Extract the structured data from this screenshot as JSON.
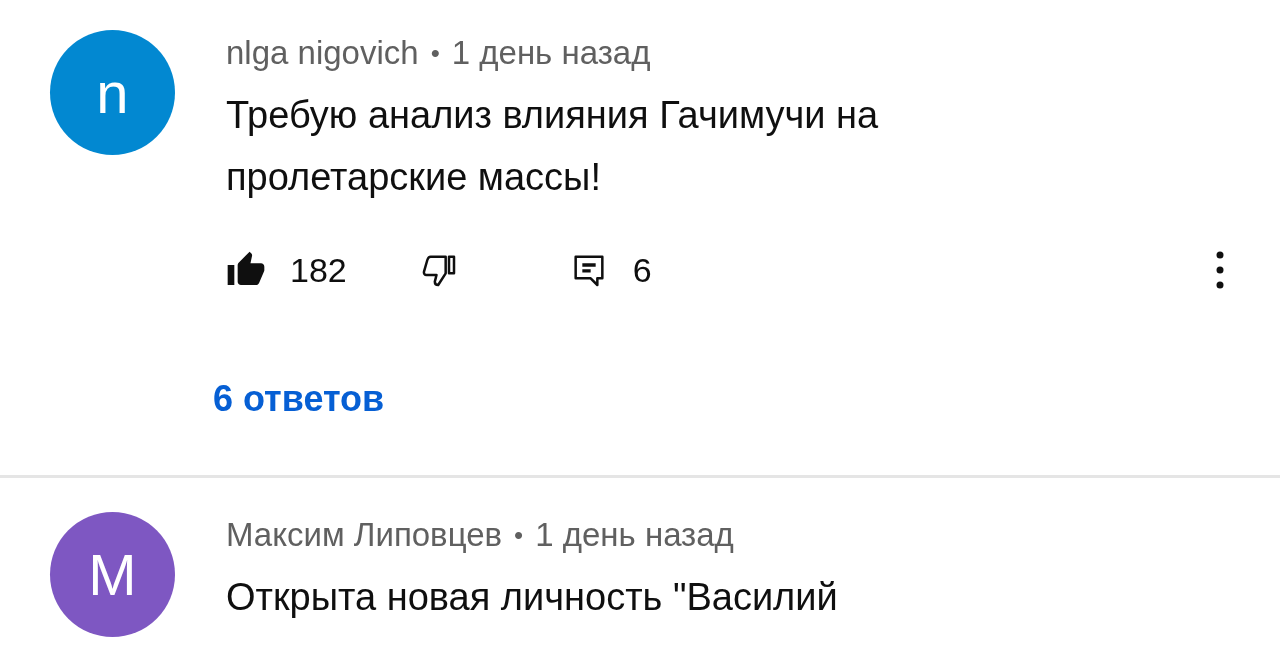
{
  "comments": [
    {
      "avatar_letter": "n",
      "color": "#0288d1",
      "author": "nlga nigovich",
      "separator": "•",
      "time": "1 день назад",
      "text": "Требую анализ влияния Гачимучи на пролетарские массы!",
      "likes": "182",
      "liked": true,
      "disliked": false,
      "reply_count": "6",
      "replies_link": "6 ответов"
    },
    {
      "avatar_letter": "M",
      "color": "#7e57c2",
      "author": "Максим Липовцев",
      "separator": "•",
      "time": "1 день назад",
      "text": "Открыта новая личность \"Василий"
    }
  ]
}
